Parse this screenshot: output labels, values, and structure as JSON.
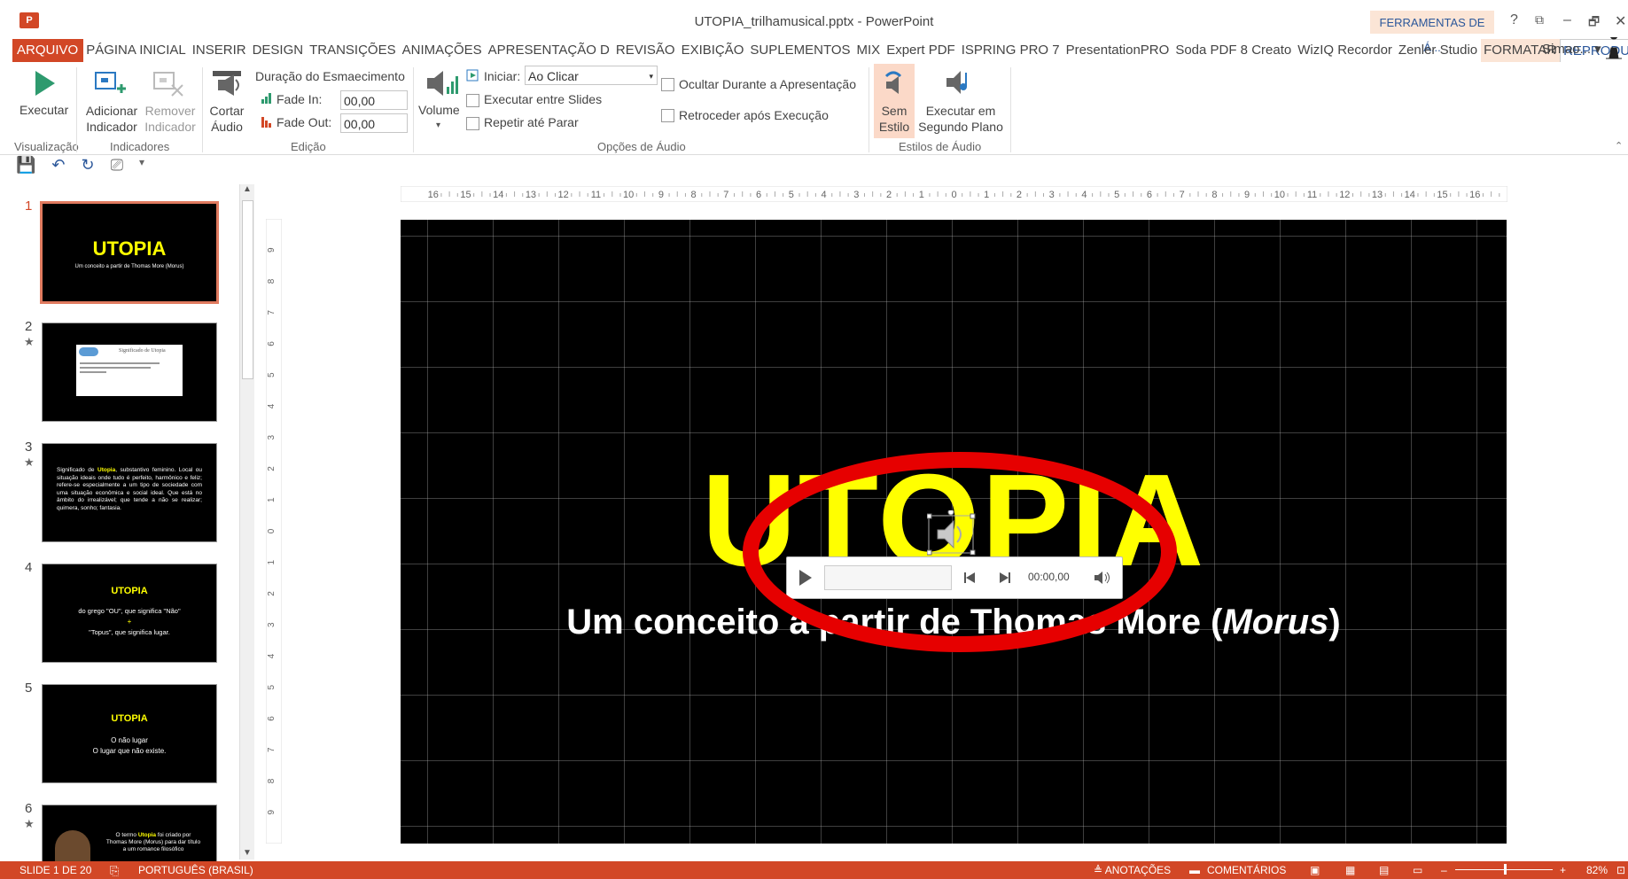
{
  "window": {
    "title": "UTOPIA_trilhamusical.pptx - PowerPoint",
    "context_tab": "FERRAMENTAS DE Á...",
    "help": "?",
    "restore": "⧉",
    "minimize": "–",
    "maximize": "🗗",
    "close": "✕"
  },
  "menu": {
    "tabs": [
      "ARQUIVO",
      "PÁGINA INICIAL",
      "INSERIR",
      "DESIGN",
      "TRANSIÇÕES",
      "ANIMAÇÕES",
      "APRESENTAÇÃO D",
      "REVISÃO",
      "EXIBIÇÃO",
      "SUPLEMENTOS",
      "MIX",
      "Expert PDF",
      "ISPRING PRO 7",
      "PresentationPRO",
      "Soda PDF 8 Creato",
      "WizIQ Recordor",
      "Zenler Studio",
      "FORMATAR",
      "REPRODUÇÃO"
    ],
    "user": "Simao... ▾"
  },
  "ribbon": {
    "visualizacao": {
      "play": "Executar",
      "group": "Visualização"
    },
    "indicadores": {
      "add": "Adicionar Indicador",
      "remove": "Remover Indicador",
      "group": "Indicadores"
    },
    "edicao": {
      "trim": "Cortar Áudio",
      "fade_duration": "Duração do Esmaecimento",
      "fade_in": "Fade In:",
      "fade_in_value": "00,00",
      "fade_out": "Fade Out:",
      "fade_out_value": "00,00",
      "group": "Edição"
    },
    "opcoes": {
      "volume": "Volume",
      "start": "Iniciar:",
      "start_value": "Ao Clicar",
      "across_slides": "Executar entre Slides",
      "loop": "Repetir até Parar",
      "hide": "Ocultar Durante a Apresentação",
      "rewind": "Retroceder após Execução",
      "group": "Opções de Áudio"
    },
    "estilos": {
      "no_style": "Sem Estilo",
      "background": "Executar em Segundo Plano",
      "group": "Estilos de Áudio"
    }
  },
  "thumbnails": [
    {
      "num": "1",
      "star": "",
      "title": "UTOPIA",
      "sub": "Um conceito a partir de Thomas More (Morus)"
    },
    {
      "num": "2",
      "star": "★",
      "title": "Significado de Utopia"
    },
    {
      "num": "3",
      "star": "★",
      "text_pre": "Significado de ",
      "text_hl": "Utopia",
      "text": ", substantivo feminino. Local ou situação ideais onde tudo é perfeito, harmônico e feliz; refere-se especialmente a um tipo de sociedade com uma situação econômica e social ideal. Que está no âmbito do irrealizável; que tende a não se realizar; quimera, sonho; fantasia."
    },
    {
      "num": "4",
      "star": "",
      "title": "UTOPIA",
      "l1": "do grego \"OU\", que significa \"Não\"",
      "l2": "+",
      "l3": "\"Topus\", que significa lugar."
    },
    {
      "num": "5",
      "star": "",
      "title": "UTOPIA",
      "l1": "O não lugar",
      "l2": "O lugar que não existe."
    },
    {
      "num": "6",
      "star": "★",
      "text_pre": "O termo ",
      "text_hl": "Utopia",
      "text": " foi criado por Thomas More (Morus) para dar título a um romance filosófico"
    }
  ],
  "hruler": [
    "16",
    "15",
    "14",
    "13",
    "12",
    "11",
    "10",
    "9",
    "8",
    "7",
    "6",
    "5",
    "4",
    "3",
    "2",
    "1",
    "0",
    "1",
    "2",
    "3",
    "4",
    "5",
    "6",
    "7",
    "8",
    "9",
    "10",
    "11",
    "12",
    "13",
    "14",
    "15",
    "16"
  ],
  "vruler": [
    "9",
    "8",
    "7",
    "6",
    "5",
    "4",
    "3",
    "2",
    "1",
    "0",
    "1",
    "2",
    "3",
    "4",
    "5",
    "6",
    "7",
    "8",
    "9"
  ],
  "slide": {
    "title": "UTOPIA",
    "subtitle_pre": "Um conceito a partir de Thomas More (",
    "subtitle_em": "Morus",
    "subtitle_post": ")"
  },
  "audio_player": {
    "time": "00:00,00"
  },
  "status": {
    "slide": "SLIDE 1 DE 20",
    "language": "PORTUGUÊS (BRASIL)",
    "notes": "≜ ANOTAÇÕES",
    "comments": "COMENTÁRIOS",
    "zoom": "82%",
    "zoom_level": 0.82
  },
  "colors": {
    "accent": "#d24726",
    "title_yellow": "#ffff00",
    "ellipse": "#e60000",
    "ribbon_blue": "#2b579a"
  }
}
